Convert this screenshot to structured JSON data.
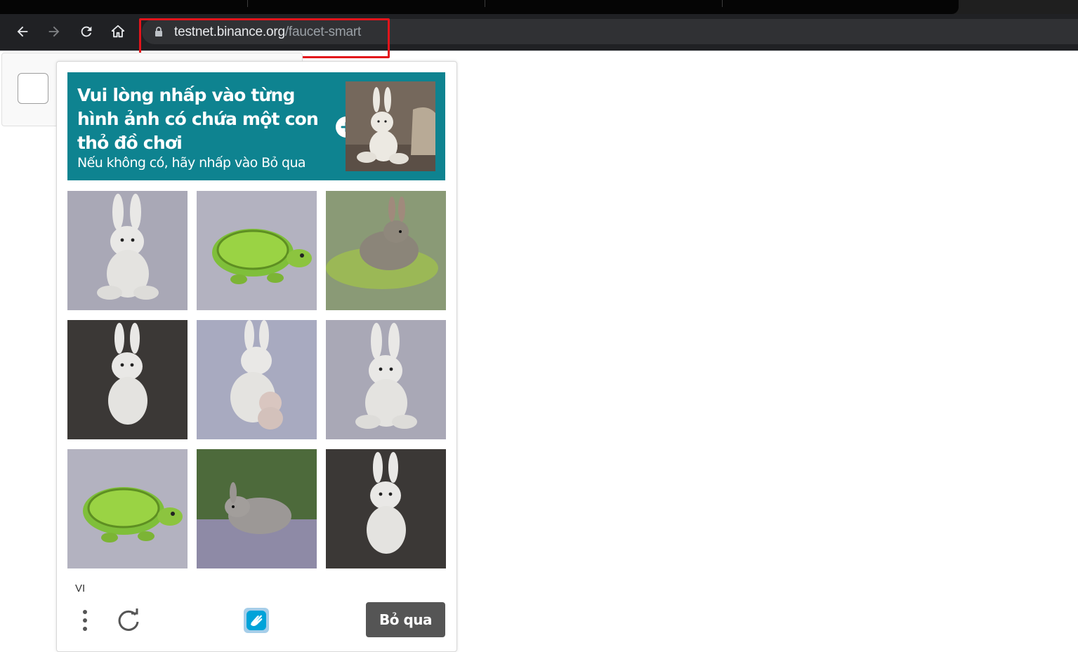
{
  "browser": {
    "url_host": "testnet.binance.org",
    "url_path": "/faucet-smart",
    "icons": [
      "back-icon",
      "forward-icon",
      "reload-icon",
      "home-icon",
      "lock-icon"
    ]
  },
  "colors": {
    "prompt_bg": "#0e8390",
    "skip_bg": "#555555",
    "highlight": "#e3141b"
  },
  "challenge": {
    "prompt_title": "Vui lòng nhấp vào từng hình ảnh có chứa một con thỏ đồ chơi",
    "prompt_subtitle": "Nếu không có, hãy nhấp vào Bỏ qua",
    "example_image": "toy-bunny-example",
    "tiles": [
      "toy-bunny",
      "toy-turtle",
      "real-rabbit-in-water",
      "toy-bunny",
      "toy-bunny-with-small-bunny",
      "toy-bunny",
      "toy-turtle",
      "real-rabbit-in-grass",
      "toy-bunny"
    ],
    "language": "VI",
    "skip_label": "Bỏ qua"
  }
}
